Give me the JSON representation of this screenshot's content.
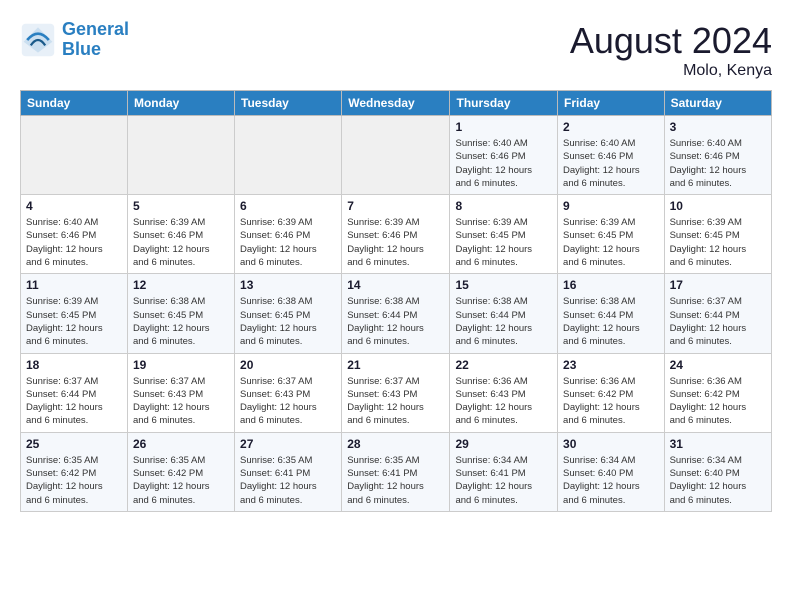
{
  "logo": {
    "line1": "General",
    "line2": "Blue"
  },
  "title": "August 2024",
  "location": "Molo, Kenya",
  "weekdays": [
    "Sunday",
    "Monday",
    "Tuesday",
    "Wednesday",
    "Thursday",
    "Friday",
    "Saturday"
  ],
  "weeks": [
    [
      {
        "day": "",
        "info": ""
      },
      {
        "day": "",
        "info": ""
      },
      {
        "day": "",
        "info": ""
      },
      {
        "day": "",
        "info": ""
      },
      {
        "day": "1",
        "info": "Sunrise: 6:40 AM\nSunset: 6:46 PM\nDaylight: 12 hours\nand 6 minutes."
      },
      {
        "day": "2",
        "info": "Sunrise: 6:40 AM\nSunset: 6:46 PM\nDaylight: 12 hours\nand 6 minutes."
      },
      {
        "day": "3",
        "info": "Sunrise: 6:40 AM\nSunset: 6:46 PM\nDaylight: 12 hours\nand 6 minutes."
      }
    ],
    [
      {
        "day": "4",
        "info": "Sunrise: 6:40 AM\nSunset: 6:46 PM\nDaylight: 12 hours\nand 6 minutes."
      },
      {
        "day": "5",
        "info": "Sunrise: 6:39 AM\nSunset: 6:46 PM\nDaylight: 12 hours\nand 6 minutes."
      },
      {
        "day": "6",
        "info": "Sunrise: 6:39 AM\nSunset: 6:46 PM\nDaylight: 12 hours\nand 6 minutes."
      },
      {
        "day": "7",
        "info": "Sunrise: 6:39 AM\nSunset: 6:46 PM\nDaylight: 12 hours\nand 6 minutes."
      },
      {
        "day": "8",
        "info": "Sunrise: 6:39 AM\nSunset: 6:45 PM\nDaylight: 12 hours\nand 6 minutes."
      },
      {
        "day": "9",
        "info": "Sunrise: 6:39 AM\nSunset: 6:45 PM\nDaylight: 12 hours\nand 6 minutes."
      },
      {
        "day": "10",
        "info": "Sunrise: 6:39 AM\nSunset: 6:45 PM\nDaylight: 12 hours\nand 6 minutes."
      }
    ],
    [
      {
        "day": "11",
        "info": "Sunrise: 6:39 AM\nSunset: 6:45 PM\nDaylight: 12 hours\nand 6 minutes."
      },
      {
        "day": "12",
        "info": "Sunrise: 6:38 AM\nSunset: 6:45 PM\nDaylight: 12 hours\nand 6 minutes."
      },
      {
        "day": "13",
        "info": "Sunrise: 6:38 AM\nSunset: 6:45 PM\nDaylight: 12 hours\nand 6 minutes."
      },
      {
        "day": "14",
        "info": "Sunrise: 6:38 AM\nSunset: 6:44 PM\nDaylight: 12 hours\nand 6 minutes."
      },
      {
        "day": "15",
        "info": "Sunrise: 6:38 AM\nSunset: 6:44 PM\nDaylight: 12 hours\nand 6 minutes."
      },
      {
        "day": "16",
        "info": "Sunrise: 6:38 AM\nSunset: 6:44 PM\nDaylight: 12 hours\nand 6 minutes."
      },
      {
        "day": "17",
        "info": "Sunrise: 6:37 AM\nSunset: 6:44 PM\nDaylight: 12 hours\nand 6 minutes."
      }
    ],
    [
      {
        "day": "18",
        "info": "Sunrise: 6:37 AM\nSunset: 6:44 PM\nDaylight: 12 hours\nand 6 minutes."
      },
      {
        "day": "19",
        "info": "Sunrise: 6:37 AM\nSunset: 6:43 PM\nDaylight: 12 hours\nand 6 minutes."
      },
      {
        "day": "20",
        "info": "Sunrise: 6:37 AM\nSunset: 6:43 PM\nDaylight: 12 hours\nand 6 minutes."
      },
      {
        "day": "21",
        "info": "Sunrise: 6:37 AM\nSunset: 6:43 PM\nDaylight: 12 hours\nand 6 minutes."
      },
      {
        "day": "22",
        "info": "Sunrise: 6:36 AM\nSunset: 6:43 PM\nDaylight: 12 hours\nand 6 minutes."
      },
      {
        "day": "23",
        "info": "Sunrise: 6:36 AM\nSunset: 6:42 PM\nDaylight: 12 hours\nand 6 minutes."
      },
      {
        "day": "24",
        "info": "Sunrise: 6:36 AM\nSunset: 6:42 PM\nDaylight: 12 hours\nand 6 minutes."
      }
    ],
    [
      {
        "day": "25",
        "info": "Sunrise: 6:35 AM\nSunset: 6:42 PM\nDaylight: 12 hours\nand 6 minutes."
      },
      {
        "day": "26",
        "info": "Sunrise: 6:35 AM\nSunset: 6:42 PM\nDaylight: 12 hours\nand 6 minutes."
      },
      {
        "day": "27",
        "info": "Sunrise: 6:35 AM\nSunset: 6:41 PM\nDaylight: 12 hours\nand 6 minutes."
      },
      {
        "day": "28",
        "info": "Sunrise: 6:35 AM\nSunset: 6:41 PM\nDaylight: 12 hours\nand 6 minutes."
      },
      {
        "day": "29",
        "info": "Sunrise: 6:34 AM\nSunset: 6:41 PM\nDaylight: 12 hours\nand 6 minutes."
      },
      {
        "day": "30",
        "info": "Sunrise: 6:34 AM\nSunset: 6:40 PM\nDaylight: 12 hours\nand 6 minutes."
      },
      {
        "day": "31",
        "info": "Sunrise: 6:34 AM\nSunset: 6:40 PM\nDaylight: 12 hours\nand 6 minutes."
      }
    ]
  ]
}
